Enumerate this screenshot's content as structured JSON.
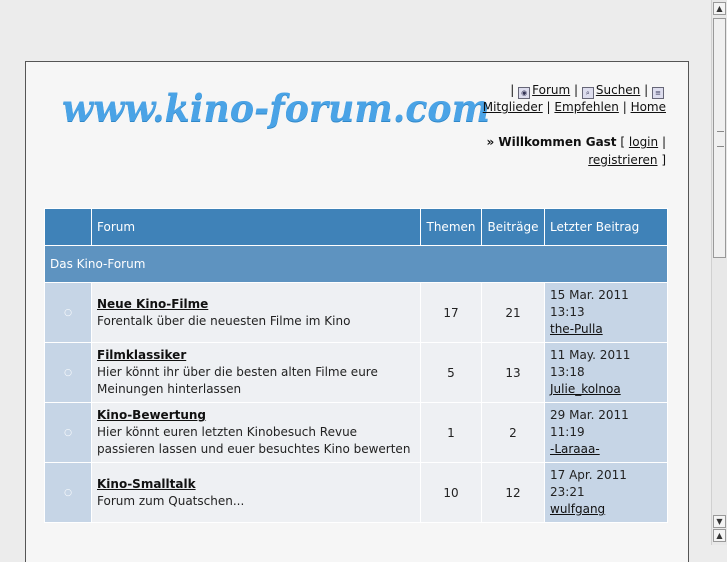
{
  "site": {
    "logo": "www.kino-forum.com"
  },
  "nav": {
    "forum": "Forum",
    "suchen": "Suchen",
    "mitglieder": "Mitglieder",
    "empfehlen": "Empfehlen",
    "home": "Home",
    "sep": "|"
  },
  "welcome": {
    "prefix": "» Willkommen Gast",
    "login": "login",
    "register": "registrieren",
    "open": "[",
    "close": "]",
    "sep": "|"
  },
  "table": {
    "headers": {
      "forum": "Forum",
      "themen": "Themen",
      "beitraege": "Beiträge",
      "letzter": "Letzter Beitrag"
    },
    "category": "Das Kino-Forum",
    "rows": [
      {
        "title": "Neue Kino-Filme",
        "desc": "Forentalk über die neuesten Filme im Kino",
        "themen": "17",
        "beitraege": "21",
        "date": "15 Mar. 2011 13:13",
        "user": "the-Pulla"
      },
      {
        "title": "Filmklassiker",
        "desc": "Hier könnt ihr über die besten alten Filme eure Meinungen hinterlassen",
        "themen": "5",
        "beitraege": "13",
        "date": "11 May. 2011 13:18",
        "user": "Julie_kolnoa"
      },
      {
        "title": "Kino-Bewertung",
        "desc": "Hier könnt euren letzten Kinobesuch Revue passieren lassen und euer besuchtes Kino bewerten",
        "themen": "1",
        "beitraege": "2",
        "date": "29 Mar. 2011 11:19",
        "user": "-Laraaa-"
      },
      {
        "title": "Kino-Smalltalk",
        "desc": "Forum zum Quatschen...",
        "themen": "10",
        "beitraege": "12",
        "date": "17 Apr. 2011 23:21",
        "user": "wulfgang"
      }
    ]
  },
  "icons": {
    "row": "circle-icon",
    "forum": "forum-icon",
    "search": "search-icon",
    "list": "list-icon"
  },
  "colors": {
    "header": "#3f82b8",
    "category": "#5e93c0",
    "logo": "#4aa3e6",
    "cell_alt": "#c6d5e6"
  }
}
